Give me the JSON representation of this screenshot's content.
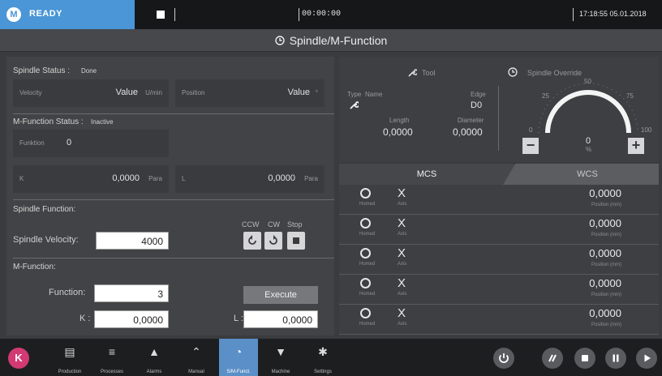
{
  "status": {
    "badge": "M",
    "label": "READY"
  },
  "timer": "00:00:00",
  "clock": "17:18:55  05.01.2018",
  "page_title": "Spindle/M-Function",
  "spindle_status": {
    "label": "Spindle Status :",
    "value": "Done",
    "velocity": {
      "label": "Velocity",
      "value": "Value",
      "unit": "U/min"
    },
    "position": {
      "label": "Position",
      "value": "Value",
      "unit": "°"
    }
  },
  "mfunc_status": {
    "label": "M-Function Status :",
    "value": "Inactive",
    "funktion": {
      "label": "Funktion",
      "value": "0"
    },
    "k": {
      "label": "K",
      "value": "0,0000",
      "unit": "Para"
    },
    "l": {
      "label": "L",
      "value": "0,0000",
      "unit": "Para"
    }
  },
  "spindle_function": {
    "label": "Spindle Function:",
    "velocity_label": "Spindle Velocity:",
    "velocity_value": "4000",
    "dir_labels": [
      "CCW",
      "CW",
      "Stop"
    ]
  },
  "m_function": {
    "label": "M-Function:",
    "function_label": "Function:",
    "function_value": "3",
    "execute": "Execute",
    "k_label": "K :",
    "k_value": "0,0000",
    "l_label": "L :",
    "l_value": "0,0000"
  },
  "tool": {
    "title": "Tool",
    "type_label": "Type",
    "name_label": "Name",
    "edge_label": "Edge",
    "edge_value": "D0",
    "length_label": "Length",
    "length_value": "0,0000",
    "diameter_label": "Diameter",
    "diameter_value": "0,0000"
  },
  "override": {
    "title": "Spindle Override",
    "value": "0",
    "unit": "%",
    "ticks": [
      "0",
      "25",
      "50",
      "75",
      "100"
    ],
    "minus": "−",
    "plus": "+"
  },
  "tabs": {
    "mcs": "MCS",
    "wcs": "WCS"
  },
  "axes": [
    {
      "homed": "Homed",
      "name": "X",
      "axis": "Axis",
      "value": "0,0000",
      "pos": "Position (mm)"
    },
    {
      "homed": "Homed",
      "name": "X",
      "axis": "Axis",
      "value": "0,0000",
      "pos": "Position (mm)"
    },
    {
      "homed": "Homed",
      "name": "X",
      "axis": "Axis",
      "value": "0,0000",
      "pos": "Position (mm)"
    },
    {
      "homed": "Homed",
      "name": "X",
      "axis": "Axis",
      "value": "0,0000",
      "pos": "Position (mm)"
    },
    {
      "homed": "Homed",
      "name": "X",
      "axis": "Axis",
      "value": "0,0000",
      "pos": "Position (mm)"
    }
  ],
  "nav": {
    "k_badge": "K",
    "items": [
      {
        "label": "Production",
        "icon": "production-icon"
      },
      {
        "label": "Processes",
        "icon": "list-icon"
      },
      {
        "label": "Alarms",
        "icon": "warning-icon"
      },
      {
        "label": "Manual",
        "icon": "manual-icon"
      },
      {
        "label": "S/M-Funct.",
        "icon": "spindle-icon"
      },
      {
        "label": "Machine",
        "icon": "machine-icon"
      },
      {
        "label": "Settings",
        "icon": "gear-icon"
      }
    ]
  }
}
